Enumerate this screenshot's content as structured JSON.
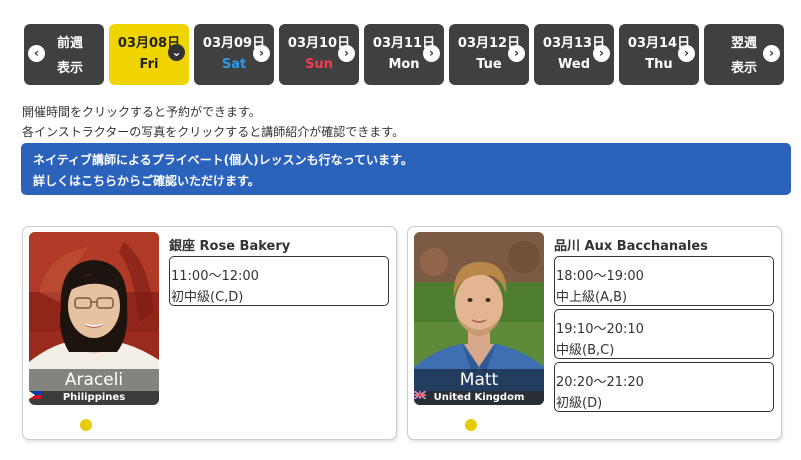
{
  "tabs": [
    {
      "date": "前週",
      "weekday": "表示",
      "kind": "prev",
      "arrow": "left"
    },
    {
      "date": "03月08日",
      "weekday": "Fri",
      "kind": "day",
      "active": true,
      "arrow": "down"
    },
    {
      "date": "03月09日",
      "weekday": "Sat",
      "kind": "day",
      "color": "sat",
      "arrow": "right"
    },
    {
      "date": "03月10日",
      "weekday": "Sun",
      "kind": "day",
      "color": "sun",
      "arrow": "right"
    },
    {
      "date": "03月11日",
      "weekday": "Mon",
      "kind": "day",
      "arrow": "right"
    },
    {
      "date": "03月12日",
      "weekday": "Tue",
      "kind": "day",
      "arrow": "right"
    },
    {
      "date": "03月13日",
      "weekday": "Wed",
      "kind": "day",
      "arrow": "right"
    },
    {
      "date": "03月14日",
      "weekday": "Thu",
      "kind": "day",
      "arrow": "right"
    },
    {
      "date": "翌週",
      "weekday": "表示",
      "kind": "next",
      "arrow": "right"
    }
  ],
  "instructions": {
    "line1": "開催時間をクリックすると予約ができます。",
    "line2": "各インストラクターの写真をクリックすると講師紹介が確認できます。"
  },
  "banner": {
    "line1": "ネイティブ講師によるプライベート(個人)レッスンも行なっています。",
    "line2": "詳しくはこちらからご確認いただけます。"
  },
  "colors": {
    "tab_bg": "#404040",
    "tab_active": "#f0d400",
    "saturday": "#2a9bf0",
    "sunday": "#f04050",
    "banner": "#2b62bb",
    "status_dot": "#e6cc00"
  },
  "instructors": [
    {
      "name": "Araceli",
      "country": "Philippines",
      "venue": "銀座 Rose Bakery",
      "slots": [
        {
          "time": "11:00〜12:00",
          "level": "初中級(C,D)"
        }
      ]
    },
    {
      "name": "Matt",
      "country": "United Kingdom",
      "venue": "品川 Aux Bacchanales",
      "slots": [
        {
          "time": "18:00〜19:00",
          "level": "中上級(A,B)"
        },
        {
          "time": "19:10〜20:10",
          "level": "中級(B,C)"
        },
        {
          "time": "20:20〜21:20",
          "level": "初級(D)"
        }
      ]
    }
  ]
}
